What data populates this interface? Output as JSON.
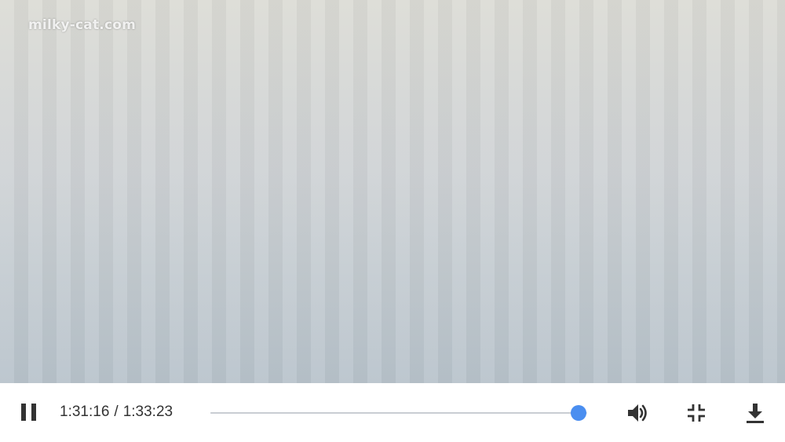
{
  "watermark": "milky-cat.com",
  "player": {
    "current_time": "1:31:16",
    "separator": "/",
    "duration": "1:33:23",
    "progress_fraction": 0.977
  },
  "icons": {
    "play_state": "pause-icon",
    "volume": "volume-icon",
    "fullscreen": "exit-fullscreen-icon",
    "download": "download-icon"
  },
  "colors": {
    "accent": "#4a8ef0",
    "icon": "#333333",
    "track": "#d6d9de"
  }
}
